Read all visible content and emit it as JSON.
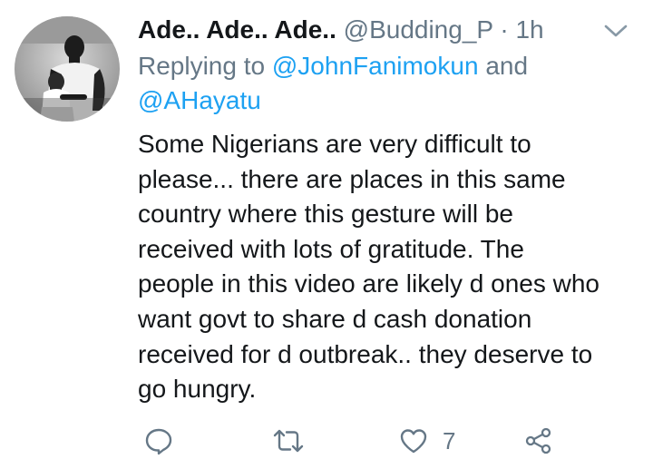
{
  "tweet": {
    "display_name": "Ade.. Ade.. Ade..",
    "handle": "@Budding_P",
    "separator": "·",
    "time": "1h",
    "reply_prefix": "Replying to",
    "mention_1": "@JohnFanimokun",
    "reply_joiner": "and",
    "mention_2": "@AHayatu",
    "text_lines": [
      "Some Nigerians are very difficult to",
      "please... there are places in this same",
      "country where this gesture will be",
      "received with lots of gratitude. The",
      "people in this video are likely d ones who",
      "want govt to share d cash donation",
      "received for d outbreak.. they deserve to",
      "go hungry."
    ],
    "like_count": "7"
  },
  "icons": {
    "caret": "chevron-down-icon",
    "reply": "reply-icon",
    "retweet": "retweet-icon",
    "like": "heart-icon",
    "share": "share-icon"
  },
  "colors": {
    "text": "#14171a",
    "secondary": "#657786",
    "link": "#1da1f2",
    "background": "#ffffff"
  }
}
